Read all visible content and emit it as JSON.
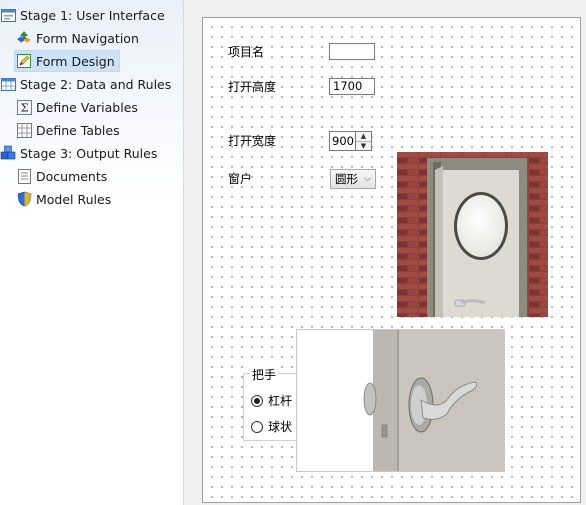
{
  "sidebar": {
    "items": [
      {
        "label": "Stage 1: User Interface",
        "icon": "window-icon"
      },
      {
        "label": "Form Navigation",
        "icon": "navigation-arrows-icon"
      },
      {
        "label": "Form Design",
        "icon": "form-edit-icon",
        "selected": true
      },
      {
        "label": "Stage 2: Data and Rules",
        "icon": "table-grid-icon"
      },
      {
        "label": "Define Variables",
        "icon": "sigma-icon"
      },
      {
        "label": "Define Tables",
        "icon": "table-icon"
      },
      {
        "label": "Stage 3: Output Rules",
        "icon": "cubes-icon"
      },
      {
        "label": "Documents",
        "icon": "document-icon"
      },
      {
        "label": "Model Rules",
        "icon": "shield-icon"
      }
    ]
  },
  "form": {
    "item_name_label": "项目名",
    "item_name_value": "",
    "open_height_label": "打开高度",
    "open_height_value": "1700",
    "open_width_label": "打开宽度",
    "open_width_value": "900",
    "window_label": "窗户",
    "window_value": "圆形",
    "handle_group_label": "把手",
    "handle_options": [
      "杠杆",
      "球状"
    ],
    "handle_selected": "杠杆"
  },
  "colors": {
    "selection": "#cde2f7",
    "brick": "#8b3a36",
    "door": "#dcdad2"
  }
}
